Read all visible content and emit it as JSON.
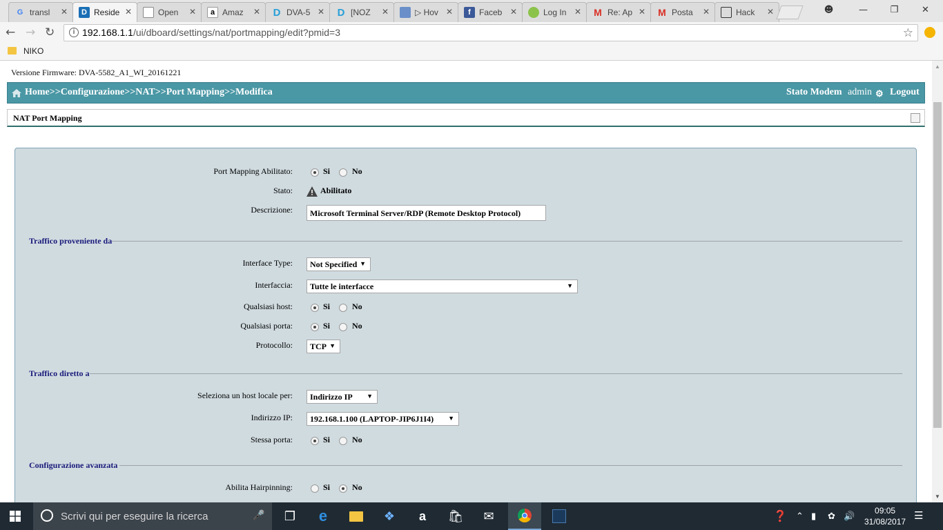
{
  "browser": {
    "tabs": [
      {
        "label": "transl",
        "icon": "google-icon"
      },
      {
        "label": "Reside",
        "icon": "dlink-icon",
        "active": true
      },
      {
        "label": "Open",
        "icon": "page-icon"
      },
      {
        "label": "Amaz",
        "icon": "amazon-icon"
      },
      {
        "label": "DVA-5",
        "icon": "dlink-icon"
      },
      {
        "label": "[NOZ",
        "icon": "dlink-icon"
      },
      {
        "label": "▷ Hov",
        "icon": "screen-icon"
      },
      {
        "label": "Faceb",
        "icon": "facebook-icon"
      },
      {
        "label": "Log In",
        "icon": "leaf-icon"
      },
      {
        "label": "Re: Ap",
        "icon": "gmail-icon"
      },
      {
        "label": "Posta",
        "icon": "gmail-icon"
      },
      {
        "label": "Hack",
        "icon": "laptop-icon"
      }
    ],
    "url_host": "192.168.1.1",
    "url_path": "/ui/dboard/settings/nat/portmapping/edit?pmid=3",
    "bookmark_folder": "NIKO"
  },
  "page": {
    "firmware": "Versione Firmware: DVA-5582_A1_WI_20161221",
    "breadcrumb": "Home>>Configurazione>>NAT>>Port Mapping>>Modifica",
    "stato_modem": "Stato Modem",
    "user": "admin",
    "logout": "Logout",
    "panel_title": "NAT Port Mapping",
    "radio_si": "Si",
    "radio_no": "No",
    "fields": {
      "enabled_label": "Port Mapping Abilitato:",
      "stato_label": "Stato:",
      "stato_value": "Abilitato",
      "descrizione_label": "Descrizione:",
      "descrizione_value": "Microsoft Terminal Server/RDP (Remote Desktop Protocol)",
      "section_source": "Traffico proveniente da",
      "interface_type_label": "Interface Type:",
      "interface_type_value": "Not Specified",
      "interfaccia_label": "Interfaccia:",
      "interfaccia_value": "Tutte le interfacce",
      "qualsiasi_host_label": "Qualsiasi host:",
      "qualsiasi_porta_label": "Qualsiasi porta:",
      "protocollo_label": "Protocollo:",
      "protocollo_value": "TCP",
      "section_dest": "Traffico diretto a",
      "host_locale_label": "Seleziona un host locale per:",
      "host_locale_value": "Indirizzo IP",
      "indirizzo_ip_label": "Indirizzo IP:",
      "indirizzo_ip_value": "192.168.1.100 (LAPTOP-JIP6J1I4)",
      "stessa_porta_label": "Stessa porta:",
      "section_adv": "Configurazione avanzata",
      "hairpinning_label": "Abilita Hairpinning:"
    },
    "radios": {
      "enabled": "si",
      "qualsiasi_host": "si",
      "qualsiasi_porta": "si",
      "stessa_porta": "si",
      "hairpinning": "no"
    }
  },
  "taskbar": {
    "search_placeholder": "Scrivi qui per eseguire la ricerca",
    "time": "09:05",
    "date": "31/08/2017"
  }
}
